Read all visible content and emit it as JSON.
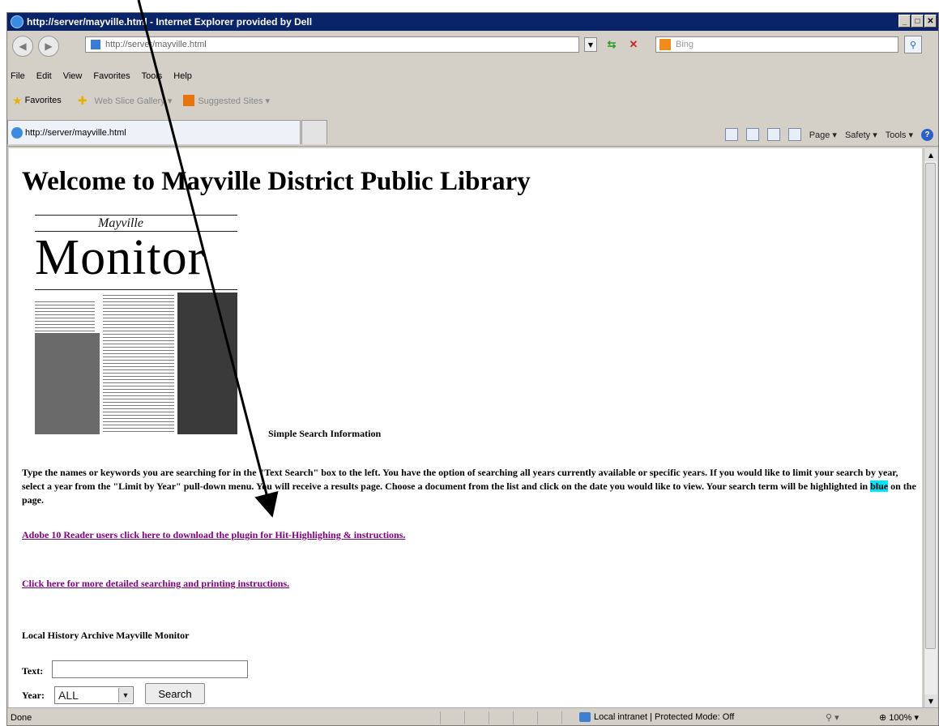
{
  "window": {
    "title": "http://server/mayville.html - Internet Explorer provided by Dell",
    "controls": {
      "minimize": "_",
      "maximize": "□",
      "close": "✕"
    }
  },
  "address_bar": {
    "url": "http://server/mayville.html",
    "search_placeholder": "Bing"
  },
  "menu": [
    "File",
    "Edit",
    "View",
    "Favorites",
    "Tools",
    "Help"
  ],
  "favorites_bar": {
    "favorites_label": "Favorites",
    "web_slice_gallery": "Web Slice Gallery ▾",
    "suggested_sites": "Suggested Sites ▾"
  },
  "tab": {
    "label": "http://server/mayville.html"
  },
  "command_bar": {
    "page": "Page ▾",
    "safety": "Safety ▾",
    "tools": "Tools ▾"
  },
  "page": {
    "title": "Welcome to Mayville District Public Library",
    "newspaper": {
      "masthead_small": "Mayville",
      "masthead": "Monitor"
    },
    "simple_search_heading": "Simple Search Information",
    "instructions_before": "Type the names or keywords you are searching for in the \"Text Search\" box to the left. You have the option of searching all years currently available or specific years. If you would like to limit your search by year, select a year from the \"Limit by Year\" pull-down menu. You will receive a results page. Choose a document from the list and click on the date you would like to view. Your search term will be highlighted in ",
    "instructions_highlight": "blue",
    "instructions_after": " on the page.",
    "link_plugin": "Adobe 10 Reader users click here to download the plugin for Hit-Highlighing & instructions.",
    "link_instructions": "Click here for more detailed searching and printing instructions.",
    "archive_heading": "Local History Archive Mayville Monitor",
    "form": {
      "text_label": "Text:",
      "text_value": "",
      "year_label": "Year:",
      "year_value": "ALL",
      "search_button": "Search"
    }
  },
  "status_bar": {
    "status": "Done",
    "zone": "Local intranet | Protected Mode: Off",
    "zoom": "100%"
  },
  "colors": {
    "title_bar": "#0a246a",
    "link": "#800080",
    "highlight": "#00e5ff"
  }
}
